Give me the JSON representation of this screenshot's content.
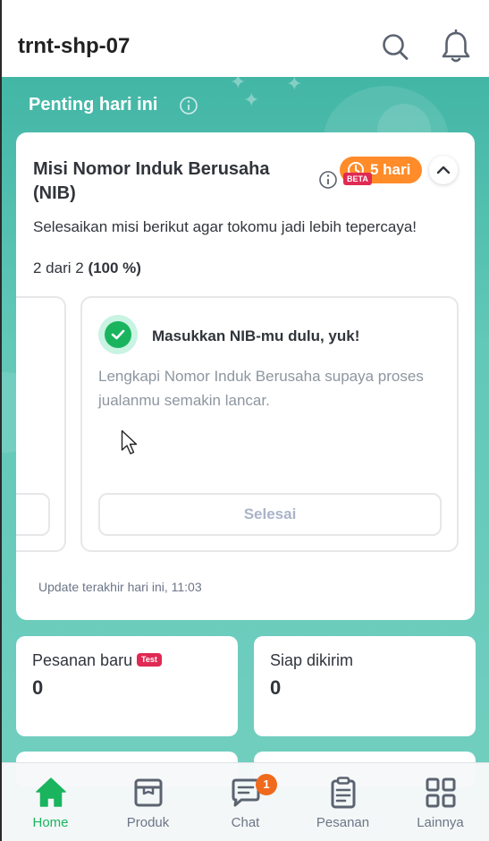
{
  "header": {
    "shop_name": "trnt-shp-07",
    "search_icon": "search-icon",
    "bell_icon": "bell-icon"
  },
  "colors": {
    "brand_green": "#1ab45f",
    "hero_teal": "#43b6a6",
    "timer_orange": "#ff8b29",
    "badge_red": "#e02954",
    "chat_badge_orange": "#ef6a1c"
  },
  "highlights": {
    "title": "Penting hari ini",
    "info_icon": "info-icon"
  },
  "mission": {
    "title": "Misi Nomor Induk Berusaha (NIB)",
    "timer": "5 hari",
    "beta": "BETA",
    "subtitle": "Selesaikan misi berikut agar tokomu jadi lebih tepercaya!",
    "progress_prefix": "2 dari 2",
    "progress_percent": "(100 %)",
    "progress_fraction": 1.0,
    "step": {
      "status": "completed",
      "title": "Masukkan NIB-mu dulu, yuk!",
      "description": "Lengkapi Nomor Induk Berusaha supaya proses jualanmu semakin lancar.",
      "button": "Selesai"
    },
    "last_update": "Update terakhir hari ini, 11:03"
  },
  "stats": [
    {
      "label": "Pesanan baru",
      "value": "0",
      "badge": "Test"
    },
    {
      "label": "Siap dikirim",
      "value": "0"
    }
  ],
  "bottom_nav": [
    {
      "label": "Home",
      "icon": "home-icon",
      "active": true
    },
    {
      "label": "Produk",
      "icon": "box-icon",
      "active": false
    },
    {
      "label": "Chat",
      "icon": "chat-icon",
      "active": false,
      "badge": "1"
    },
    {
      "label": "Pesanan",
      "icon": "clipboard-icon",
      "active": false
    },
    {
      "label": "Lainnya",
      "icon": "grid-icon",
      "active": false
    }
  ]
}
